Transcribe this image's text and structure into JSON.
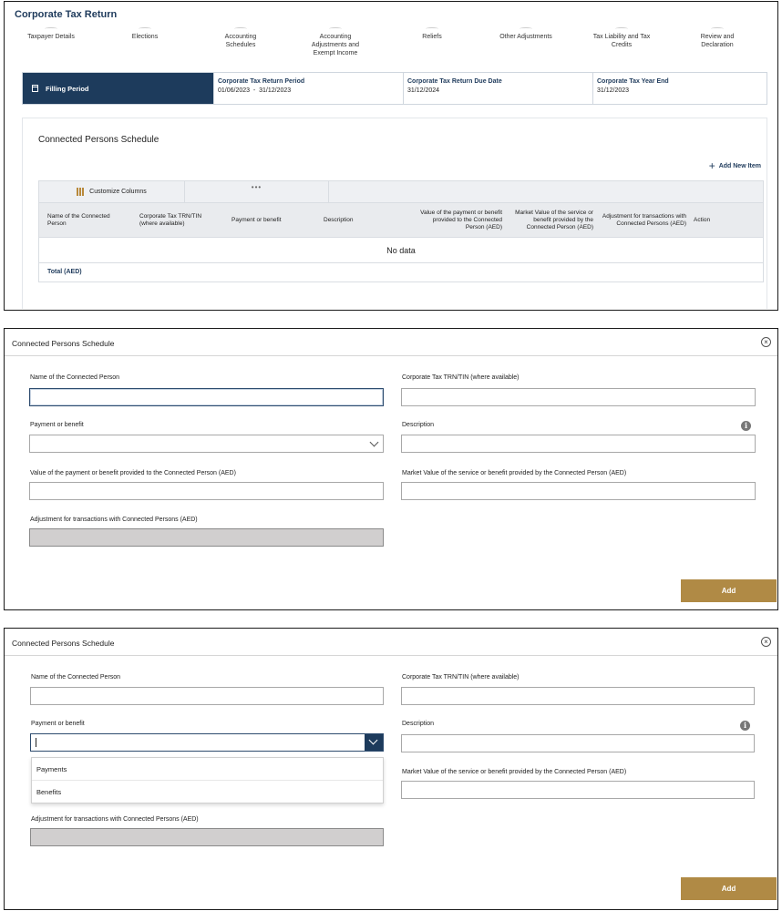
{
  "return_view": {
    "title": "Corporate Tax Return",
    "steps": [
      "Taxpayer Details",
      "Elections",
      "Accounting Schedules",
      "Accounting Adjustments and Exempt Income",
      "Reliefs",
      "Other Adjustments",
      "Tax Liability and Tax Credits",
      "Review and Declaration"
    ],
    "filing_period": {
      "label": "Filling Period",
      "return_period_label": "Corporate Tax Return Period",
      "return_period_value": "01/06/2023  -  31/12/2023",
      "due_date_label": "Corporate Tax Return Due Date",
      "due_date_value": "31/12/2024",
      "year_end_label": "Corporate Tax Year End",
      "year_end_value": "31/12/2023"
    },
    "schedule": {
      "title": "Connected Persons Schedule",
      "add_new_label": "Add New Item",
      "customize_label": "Customize Columns",
      "more_label": "•••",
      "columns": [
        "Name of the Connected Person",
        "Corporate Tax TRN/TIN (where available)",
        "Payment or benefit",
        "Description",
        "Value of the payment or benefit provided to the Connected Person (AED)",
        "Market Value of the service or benefit provided by the Connected Person (AED)",
        "Adjustment for transactions with Connected Persons (AED)",
        "Action"
      ],
      "empty_text": "No data",
      "total_label": "Total (AED)"
    }
  },
  "dialog": {
    "title": "Connected Persons Schedule",
    "close_icon": "×",
    "fields": {
      "name_label": "Name of the Connected Person",
      "name_value": "",
      "trn_label": "Corporate Tax TRN/TIN (where available)",
      "trn_value": "",
      "payment_label": "Payment or benefit",
      "payment_value": "",
      "description_label": "Description",
      "description_value": "",
      "info_icon": "i",
      "value_label": "Value of the payment or benefit provided to the Connected Person (AED)",
      "value_value": "",
      "market_label": "Market Value of the service or benefit provided by the Connected Person (AED)",
      "market_value": "",
      "adjustment_label": "Adjustment for transactions with Connected Persons (AED)",
      "adjustment_value": ""
    },
    "add_label": "Add"
  },
  "dropdown_options": [
    "Payments",
    "Benefits"
  ],
  "colors": {
    "navy": "#1d3b5c",
    "gold": "#b08a45",
    "disabled_gray": "#d1cfcf"
  }
}
